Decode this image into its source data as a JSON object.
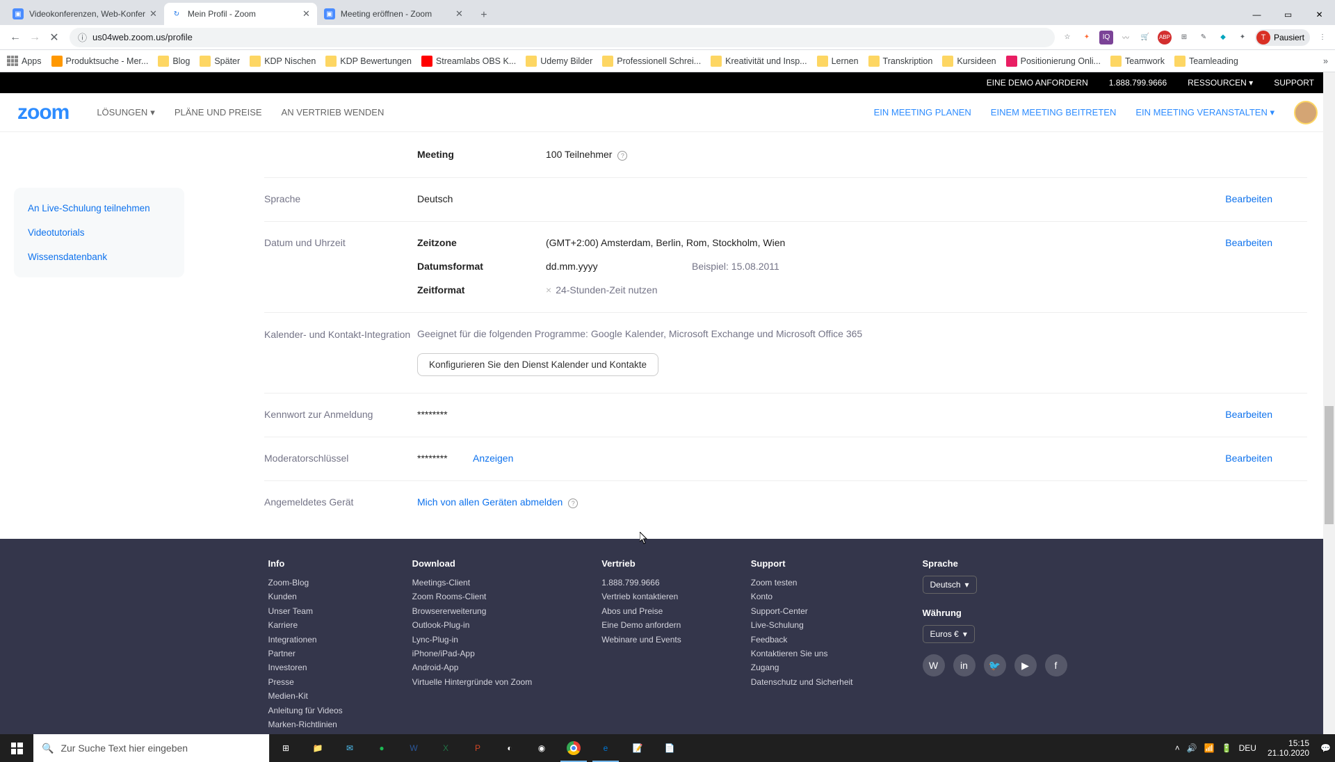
{
  "tabs": [
    {
      "title": "Videokonferenzen, Web-Konfer",
      "fav": "📹"
    },
    {
      "title": "Mein Profil - Zoom",
      "fav": "↻"
    },
    {
      "title": "Meeting eröffnen - Zoom",
      "fav": "📹"
    }
  ],
  "url": "us04web.zoom.us/profile",
  "profile_chip": "Pausiert",
  "bookmarks": [
    "Apps",
    "Produktsuche - Mer...",
    "Blog",
    "Später",
    "KDP Nischen",
    "KDP Bewertungen",
    "Streamlabs OBS K...",
    "Udemy Bilder",
    "Professionell Schrei...",
    "Kreativität und Insp...",
    "Lernen",
    "Transkription",
    "Kursideen",
    "Positionierung Onli...",
    "Teamwork",
    "Teamleading"
  ],
  "topbar": {
    "demo": "EINE DEMO ANFORDERN",
    "phone": "1.888.799.9666",
    "res": "RESSOURCEN",
    "support": "SUPPORT"
  },
  "nav": {
    "logo": "zoom",
    "left": [
      "LÖSUNGEN",
      "PLÄNE UND PREISE",
      "AN VERTRIEB WENDEN"
    ],
    "right": [
      "EIN MEETING PLANEN",
      "EINEM MEETING BEITRETEN",
      "EIN MEETING VERANSTALTEN"
    ]
  },
  "sidebar": [
    "An Live-Schulung teilnehmen",
    "Videotutorials",
    "Wissensdatenbank"
  ],
  "profile": {
    "meeting_lbl": "Meeting",
    "meeting_val": "100 Teilnehmer",
    "lang_lbl": "Sprache",
    "lang_val": "Deutsch",
    "dt_lbl": "Datum und Uhrzeit",
    "tz_lbl": "Zeitzone",
    "tz_val": "(GMT+2:00) Amsterdam, Berlin, Rom, Stockholm, Wien",
    "datefmt_lbl": "Datumsformat",
    "datefmt_val": "dd.mm.yyyy",
    "datefmt_ex": "Beispiel:  15.08.2011",
    "timefmt_lbl": "Zeitformat",
    "timefmt_val": "24-Stunden-Zeit nutzen",
    "cal_lbl": "Kalender- und Kontakt-Integration",
    "cal_desc": "Geeignet für die folgenden Programme: Google Kalender, Microsoft Exchange und Microsoft Office 365",
    "cal_btn": "Konfigurieren Sie den Dienst Kalender und Kontakte",
    "pw_lbl": "Kennwort zur Anmeldung",
    "pw_val": "********",
    "host_lbl": "Moderatorschlüssel",
    "host_val": "********",
    "show": "Anzeigen",
    "device_lbl": "Angemeldetes Gerät",
    "device_link": "Mich von allen Geräten abmelden",
    "edit": "Bearbeiten"
  },
  "footer": {
    "cols": [
      {
        "h": "Info",
        "links": [
          "Zoom-Blog",
          "Kunden",
          "Unser Team",
          "Karriere",
          "Integrationen",
          "Partner",
          "Investoren",
          "Presse",
          "Medien-Kit",
          "Anleitung für Videos",
          "Marken-Richtlinien"
        ]
      },
      {
        "h": "Download",
        "links": [
          "Meetings-Client",
          "Zoom Rooms-Client",
          "Browsererweiterung",
          "Outlook-Plug-in",
          "Lync-Plug-in",
          "iPhone/iPad-App",
          "Android-App",
          "Virtuelle Hintergründe von Zoom"
        ]
      },
      {
        "h": "Vertrieb",
        "links": [
          "1.888.799.9666",
          "Vertrieb kontaktieren",
          "Abos und Preise",
          "Eine Demo anfordern",
          "Webinare und Events"
        ]
      },
      {
        "h": "Support",
        "links": [
          "Zoom testen",
          "Konto",
          "Support-Center",
          "Live-Schulung",
          "Feedback",
          "Kontaktieren Sie uns",
          "Zugang",
          "Datenschutz und Sicherheit"
        ]
      }
    ],
    "lang_h": "Sprache",
    "lang_v": "Deutsch",
    "cur_h": "Währung",
    "cur_v": "Euros €"
  },
  "taskbar": {
    "search": "Zur Suche Text hier eingeben",
    "time": "15:15",
    "date": "21.10.2020",
    "lang": "DEU"
  }
}
